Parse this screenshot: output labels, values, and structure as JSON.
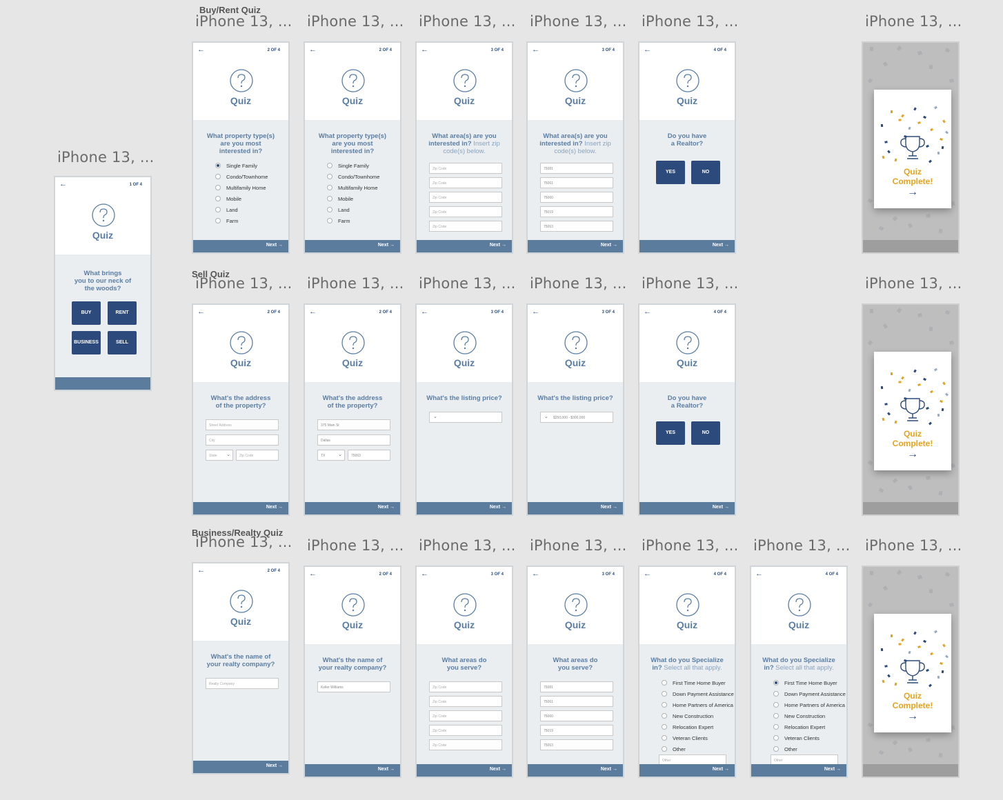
{
  "frame_title": "iPhone 13, ...",
  "sections": {
    "buy_rent": "Buy/Rent Quiz",
    "sell": "Sell Quiz",
    "business": "Business/Realty Quiz"
  },
  "common": {
    "quiz": "Quiz",
    "next": "Next",
    "back_icon": "arrow-left-icon",
    "quiz_icon": "question-circle-icon",
    "complete_line1": "Quiz",
    "complete_line2": "Complete!"
  },
  "steps": {
    "s1": "1 OF 4",
    "s2": "2 OF 4",
    "s3": "3 OF 4",
    "s4": "4 OF 4"
  },
  "start": {
    "question": [
      "What brings",
      "you to our neck of",
      "the woods?"
    ],
    "buttons": [
      "BUY",
      "RENT",
      "BUSINESS",
      "SELL"
    ]
  },
  "questions": {
    "property_type": [
      "What property type(s)",
      "are you most",
      "interested in?"
    ],
    "area_line1_bold": "What area(s) are you",
    "area_line2_bold": "interested in?",
    "area_line2_light": " Insert zip",
    "area_line3_light": "code(s) below.",
    "realtor": [
      "Do you have",
      "a Realtor?"
    ],
    "address": [
      "What's the address",
      "of the property?"
    ],
    "listing_price": "What's the listing price?",
    "realty_company": [
      "What's the name of",
      "your realty company?"
    ],
    "areas_serve": [
      "What areas do",
      "you serve?"
    ],
    "specialize_bold1": "What do you Specialize",
    "specialize_bold2": "in?",
    "specialize_light": " Select all that apply."
  },
  "property_types": [
    "Single Family",
    "Condo/Townhome",
    "Multifamily Home",
    "Mobile",
    "Land",
    "Farm"
  ],
  "specialties": [
    "First Time Home Buyer",
    "Down Payment Assistance",
    "Home Partners of America",
    "New Construction",
    "Relocation Expert",
    "Veteran Clients",
    "Other"
  ],
  "yes_no": [
    "YES",
    "NO"
  ],
  "placeholders": {
    "zip": "Zip Code",
    "street": "Street Address",
    "city": "City",
    "state": "State",
    "company": "Realty Company",
    "other": "Other"
  },
  "filled": {
    "zips": [
      "75081",
      "75061",
      "75060",
      "75019",
      "75063"
    ],
    "street": "375 Main St",
    "city": "Dallas",
    "state": "TX",
    "zip": "75063",
    "price": "$250,000 - $300,000",
    "company": "Keller Williams"
  },
  "colors": {
    "navy": "#2d4a7c",
    "accent": "#e9a21c",
    "bar": "#5c7c9e",
    "heading": "#5b7ea5"
  }
}
